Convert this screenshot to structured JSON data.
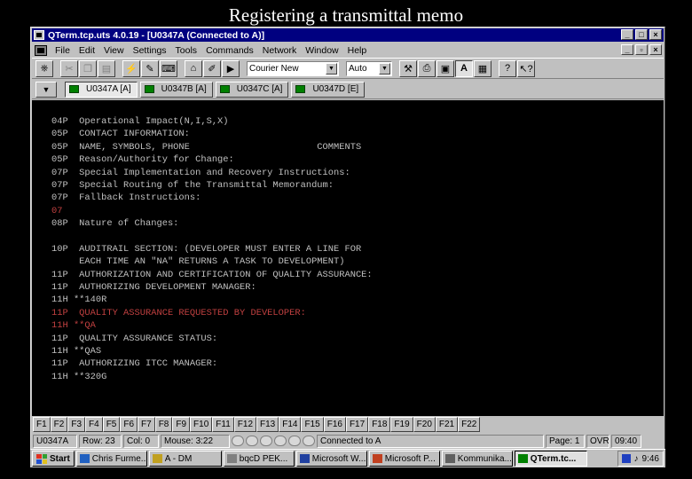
{
  "slide_title": "Registering a transmittal memo",
  "window": {
    "title": "QTerm.tcp.uts 4.0.19 - [U0347A (Connected to A)]"
  },
  "menu": [
    "File",
    "Edit",
    "View",
    "Settings",
    "Tools",
    "Commands",
    "Network",
    "Window",
    "Help"
  ],
  "toolbar": {
    "font_select": "Courier New",
    "size_select": "Auto"
  },
  "sessions": [
    {
      "label": "U0347A [A]",
      "active": true
    },
    {
      "label": "U0347B [A]",
      "active": false
    },
    {
      "label": "U0347C [A]",
      "active": false
    },
    {
      "label": "U0347D [E]",
      "active": false
    }
  ],
  "terminal_lines": [
    {
      "text": "04P  Operational Impact(N,I,S,X)",
      "color": "#c0c0c0"
    },
    {
      "text": "05P  CONTACT INFORMATION:",
      "color": "#c0c0c0"
    },
    {
      "text": "05P  NAME, SYMBOLS, PHONE                       COMMENTS",
      "color": "#c0c0c0"
    },
    {
      "text": "05P  Reason/Authority for Change:",
      "color": "#c0c0c0"
    },
    {
      "text": "07P  Special Implementation and Recovery Instructions:",
      "color": "#c0c0c0"
    },
    {
      "text": "07P  Special Routing of the Transmittal Memorandum:",
      "color": "#c0c0c0"
    },
    {
      "text": "07P  Fallback Instructions:",
      "color": "#c0c0c0"
    },
    {
      "text": "07",
      "color": "#c04040"
    },
    {
      "text": "08P  Nature of Changes:",
      "color": "#c0c0c0"
    },
    {
      "text": "",
      "color": "#c0c0c0"
    },
    {
      "text": "10P  AUDITRAIL SECTION: (DEVELOPER MUST ENTER A LINE FOR",
      "color": "#c0c0c0"
    },
    {
      "text": "     EACH TIME AN \"NA\" RETURNS A TASK TO DEVELOPMENT)",
      "color": "#c0c0c0"
    },
    {
      "text": "11P  AUTHORIZATION AND CERTIFICATION OF QUALITY ASSURANCE:",
      "color": "#c0c0c0"
    },
    {
      "text": "11P  AUTHORIZING DEVELOPMENT MANAGER:",
      "color": "#c0c0c0"
    },
    {
      "text": "11H **140R",
      "color": "#c0c0c0"
    },
    {
      "text": "11P  QUALITY ASSURANCE REQUESTED BY DEVELOPER:",
      "color": "#c04040"
    },
    {
      "text": "11H **QA",
      "color": "#c04040"
    },
    {
      "text": "11P  QUALITY ASSURANCE STATUS:",
      "color": "#c0c0c0"
    },
    {
      "text": "11H **QAS",
      "color": "#c0c0c0"
    },
    {
      "text": "11P  AUTHORIZING ITCC MANAGER:",
      "color": "#c0c0c0"
    },
    {
      "text": "11H **320G",
      "color": "#c0c0c0"
    }
  ],
  "fkeys": [
    "F1",
    "F2",
    "F3",
    "F4",
    "F5",
    "F6",
    "F7",
    "F8",
    "F9",
    "F10",
    "F11",
    "F12",
    "F13",
    "F14",
    "F15",
    "F16",
    "F17",
    "F18",
    "F19",
    "F20",
    "F21",
    "F22"
  ],
  "status": {
    "session": "U0347A",
    "row": "Row: 23",
    "col": "Col: 0",
    "mouse": "Mouse: 3:22",
    "connection": "Connected to A",
    "page": "Page: 1",
    "mode": "OVR",
    "time": "09:40"
  },
  "taskbar": {
    "start_label": "Start",
    "tasks": [
      {
        "label": "Chris Furme...",
        "active": false
      },
      {
        "label": "A - DM",
        "active": false
      },
      {
        "label": "bqcD PEK...",
        "active": false
      },
      {
        "label": "Microsoft W...",
        "active": false
      },
      {
        "label": "Microsoft P...",
        "active": false
      },
      {
        "label": "Kommunika...",
        "active": false
      },
      {
        "label": "QTerm.tc...",
        "active": true
      }
    ],
    "clock": "9:46"
  }
}
